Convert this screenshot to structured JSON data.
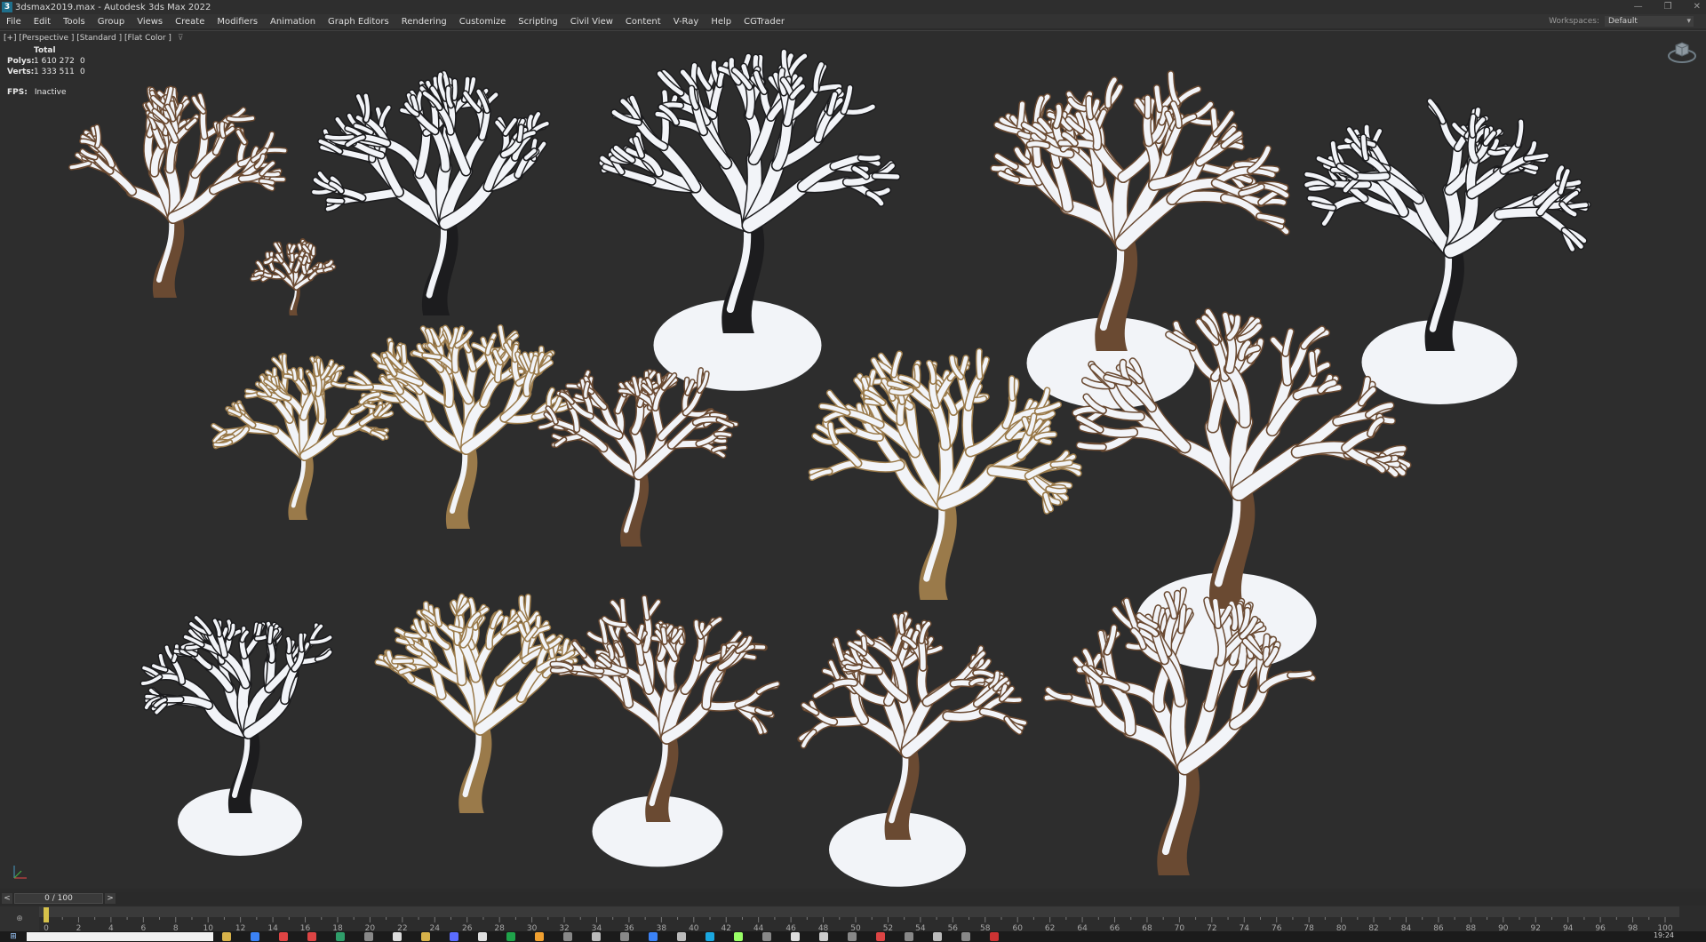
{
  "window": {
    "app_icon_glyph": "3",
    "title": "3dsmax2019.max - Autodesk 3ds Max 2022",
    "controls": [
      "—",
      "❐",
      "✕"
    ]
  },
  "menu": {
    "items": [
      "File",
      "Edit",
      "Tools",
      "Group",
      "Views",
      "Create",
      "Modifiers",
      "Animation",
      "Graph Editors",
      "Rendering",
      "Customize",
      "Scripting",
      "Civil View",
      "Content",
      "V-Ray",
      "Help",
      "CGTrader"
    ],
    "workspaces_label": "Workspaces:",
    "workspaces_value": "Default"
  },
  "viewport": {
    "label": "[+] [Perspective ] [Standard ] [Flat Color ]",
    "stats": {
      "header": "Total",
      "polys_label": "Polys:",
      "polys_value": "1 610 272",
      "polys_sel": "0",
      "verts_label": "Verts:",
      "verts_value": "1 333 511",
      "verts_sel": "0"
    },
    "fps_label": "FPS:",
    "fps_value": "Inactive",
    "object_count": 16,
    "icons": [
      "viewcube-icon",
      "axis-tripod-icon",
      "filter-icon"
    ],
    "colors": {
      "background": "#2d2d2d",
      "snow": "#f2f4f8",
      "bark_brown": "#6a4a32",
      "bark_dark": "#1c1c1e",
      "bark_tan": "#9a7a4a"
    }
  },
  "time_slider": {
    "prev": "<",
    "next": ">",
    "value": "0 / 100"
  },
  "track_bar": {
    "ticks": [
      "0",
      "2",
      "4",
      "6",
      "8",
      "10",
      "12",
      "14",
      "16",
      "18",
      "20",
      "22",
      "24",
      "26",
      "28",
      "30",
      "32",
      "34",
      "36",
      "38",
      "40",
      "42",
      "44",
      "46",
      "48",
      "50",
      "52",
      "54",
      "56",
      "58",
      "60",
      "62",
      "64",
      "66",
      "68",
      "70",
      "72",
      "74",
      "76",
      "78",
      "80",
      "82",
      "84",
      "86",
      "88",
      "90",
      "92",
      "94",
      "96",
      "98",
      "100"
    ],
    "mini_label": "⊕"
  },
  "taskbar": {
    "start_glyph": "⊞",
    "clock": "19:24",
    "icon_colors": [
      "#d7b24a",
      "#3b82f6",
      "#e04444",
      "#d44",
      "#2f9e6a",
      "#888",
      "#ddd",
      "#d7b24a",
      "#5b6cff",
      "#e0e0e0",
      "#1fa34a",
      "#f0a030",
      "#888",
      "#bbb",
      "#888",
      "#3b82f6",
      "#bbb",
      "#1aa7e0",
      "#9f6",
      "#888",
      "#ddd",
      "#ccc",
      "#888",
      "#d44",
      "#888",
      "#bbb",
      "#888",
      "#c33"
    ]
  }
}
